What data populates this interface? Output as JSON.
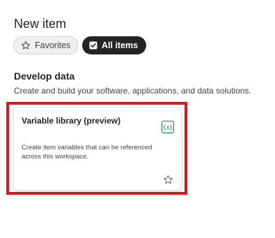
{
  "header": {
    "title": "New item"
  },
  "filters": {
    "favorites_label": "Favorites",
    "all_items_label": "All items"
  },
  "section": {
    "title": "Develop data",
    "description": "Create and build your software, applications, and data solutions."
  },
  "card": {
    "title": "Variable library (preview)",
    "icon_glyph": "{x}",
    "icon": "variable-library-icon",
    "description": "Create item variables that can be referenced across this workspace.",
    "favorite_icon": "star-outline-icon"
  },
  "colors": {
    "highlight": "#e0161e",
    "pill_active_bg": "#242424",
    "icon_accent": "#107c41"
  }
}
